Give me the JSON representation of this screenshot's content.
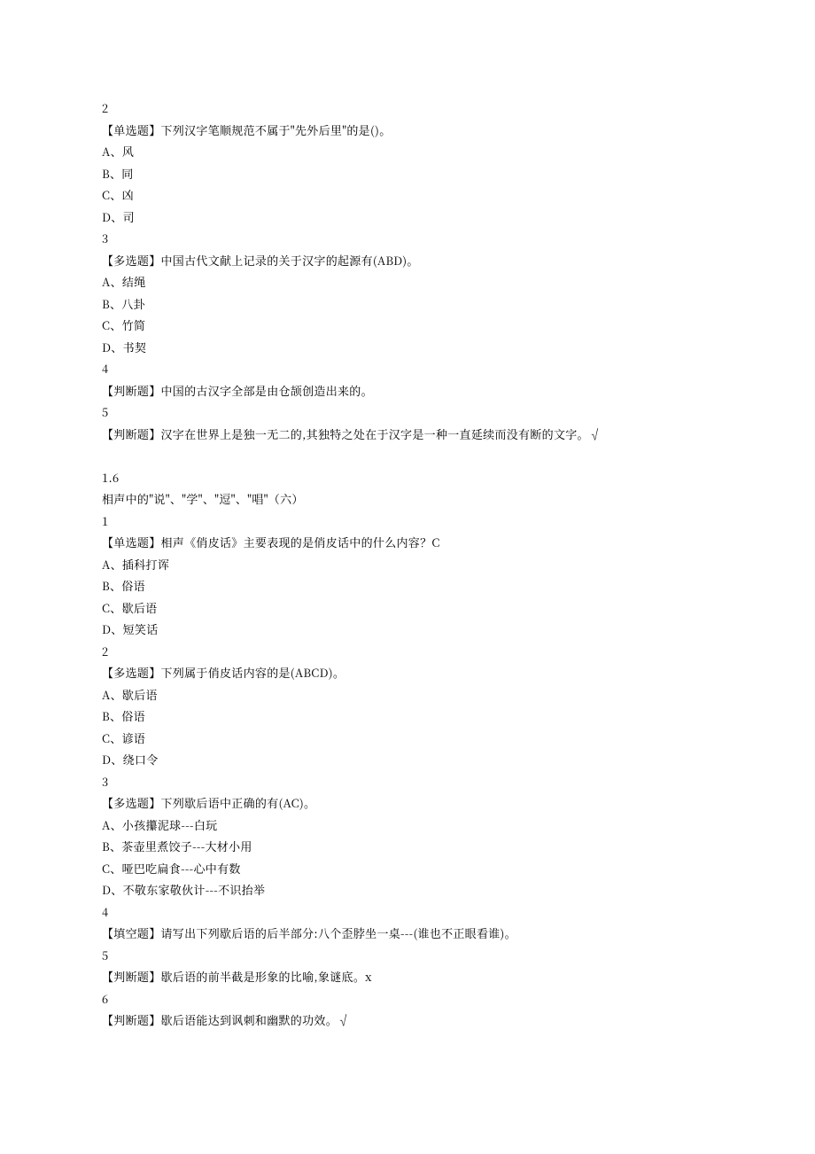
{
  "lines": [
    "2",
    "【单选题】下列汉字笔顺规范不属于\"先外后里\"的是()。",
    "A、风",
    "B、同",
    "C、凶",
    "D、司",
    "3",
    "【多选题】中国古代文献上记录的关于汉字的起源有(ABD)。",
    "A、结绳",
    "B、八卦",
    "C、竹简",
    "D、书契",
    "4",
    "【判断题】中国的古汉字全部是由仓颉创造出来的。",
    "5",
    "【判断题】汉字在世界上是独一无二的,其独特之处在于汉字是一种一直延续而没有断的文字。√",
    "",
    "1.6",
    "相声中的\"说\"、\"学\"、\"逗\"、\"唱\"（六）",
    "1",
    "【单选题】相声《俏皮话》主要表现的是俏皮话中的什么内容？C",
    "A、插科打诨",
    "B、俗语",
    "C、歇后语",
    "D、短笑话",
    "2",
    "【多选题】下列属于俏皮话内容的是(ABCD)。",
    "A、歇后语",
    "B、俗语",
    "C、谚语",
    "D、绕口令",
    "3",
    "【多选题】下列歇后语中正确的有(AC)。",
    "A、小孩攥泥球---白玩",
    "B、茶壶里煮饺子---大材小用",
    "C、哑巴吃扁食---心中有数",
    "D、不敬东家敬伙计---不识抬举",
    "4",
    "【填空题】请写出下列歇后语的后半部分:八个歪脖坐一桌---(谁也不正眼看谁)。",
    "5",
    "【判断题】歇后语的前半截是形象的比喻,象谜底。x",
    "6",
    "【判断题】歇后语能达到讽刺和幽默的功效。√"
  ]
}
